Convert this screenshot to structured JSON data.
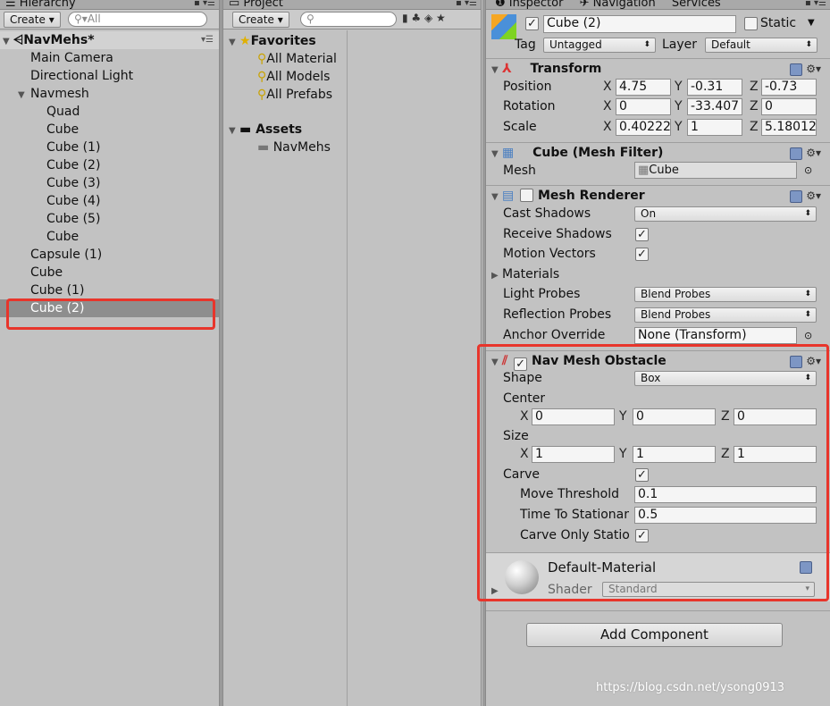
{
  "hierarchy": {
    "tab": "Hierarchy",
    "create_label": "Create",
    "search_placeholder": "All",
    "scene": "NavMehs*",
    "items": [
      {
        "label": "Main Camera",
        "depth": 1
      },
      {
        "label": "Directional Light",
        "depth": 1
      },
      {
        "label": "Navmesh",
        "depth": 1,
        "expanded": true
      },
      {
        "label": "Quad",
        "depth": 2
      },
      {
        "label": "Cube",
        "depth": 2
      },
      {
        "label": "Cube (1)",
        "depth": 2
      },
      {
        "label": "Cube (2)",
        "depth": 2
      },
      {
        "label": "Cube (3)",
        "depth": 2
      },
      {
        "label": "Cube (4)",
        "depth": 2
      },
      {
        "label": "Cube (5)",
        "depth": 2
      },
      {
        "label": "Cube",
        "depth": 2
      },
      {
        "label": "Capsule (1)",
        "depth": 1
      },
      {
        "label": "Cube",
        "depth": 1
      },
      {
        "label": "Cube (1)",
        "depth": 1
      },
      {
        "label": "Cube (2)",
        "depth": 1,
        "selected": true
      }
    ]
  },
  "project": {
    "tab": "Project",
    "create_label": "Create",
    "favorites_label": "Favorites",
    "favorites": [
      "All Material",
      "All Models",
      "All Prefabs"
    ],
    "assets_label": "Assets",
    "assets": [
      "NavMehs"
    ]
  },
  "inspector": {
    "tab_inspector": "Inspector",
    "tab_navigation": "Navigation",
    "tab_services": "Services",
    "object_name": "Cube (2)",
    "static_label": "Static",
    "tag_label": "Tag",
    "tag_value": "Untagged",
    "layer_label": "Layer",
    "layer_value": "Default",
    "transform": {
      "title": "Transform",
      "position_label": "Position",
      "rotation_label": "Rotation",
      "scale_label": "Scale",
      "position": [
        "4.75",
        "-0.31",
        "-0.73"
      ],
      "rotation": [
        "0",
        "-33.407",
        "0"
      ],
      "scale": [
        "0.40222",
        "1",
        "5.18012"
      ]
    },
    "mesh_filter": {
      "title": "Cube (Mesh Filter)",
      "mesh_label": "Mesh",
      "mesh_value": "Cube"
    },
    "mesh_renderer": {
      "title": "Mesh Renderer",
      "cast_shadows_label": "Cast Shadows",
      "cast_shadows_value": "On",
      "receive_shadows_label": "Receive Shadows",
      "motion_vectors_label": "Motion Vectors",
      "materials_label": "Materials",
      "light_probes_label": "Light Probes",
      "light_probes_value": "Blend Probes",
      "reflection_probes_label": "Reflection Probes",
      "reflection_probes_value": "Blend Probes",
      "anchor_override_label": "Anchor Override",
      "anchor_override_value": "None (Transform)"
    },
    "nav_mesh_obstacle": {
      "title": "Nav Mesh Obstacle",
      "shape_label": "Shape",
      "shape_value": "Box",
      "center_label": "Center",
      "center": [
        "0",
        "0",
        "0"
      ],
      "size_label": "Size",
      "size": [
        "1",
        "1",
        "1"
      ],
      "carve_label": "Carve",
      "move_threshold_label": "Move Threshold",
      "move_threshold_value": "0.1",
      "time_to_stationary_label": "Time To Stationar",
      "time_to_stationary_value": "0.5",
      "carve_only_stationary_label": "Carve Only Statio"
    },
    "material": {
      "name": "Default-Material",
      "shader_label": "Shader",
      "shader_value": "Standard"
    },
    "add_component_label": "Add Component"
  },
  "axes": {
    "x": "X",
    "y": "Y",
    "z": "Z"
  },
  "watermark": "https://blog.csdn.net/ysong0913",
  "colors": {
    "highlight": "#e8352b",
    "selection": "#8e8e8e",
    "panel": "#c2c2c2"
  }
}
